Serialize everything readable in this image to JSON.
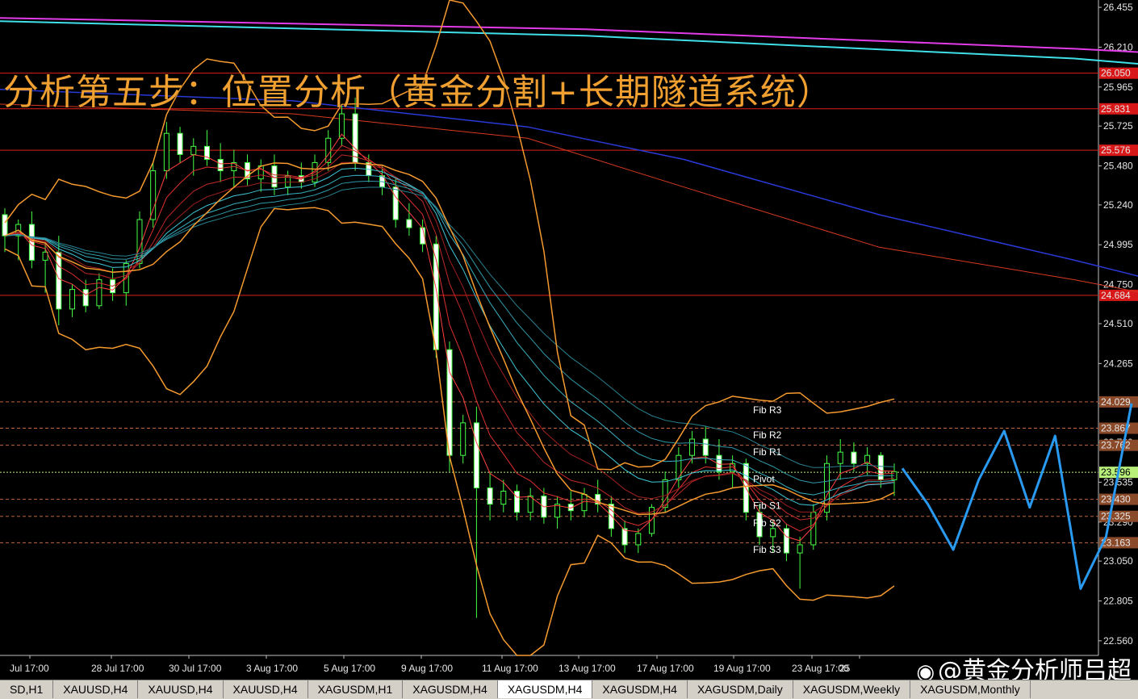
{
  "title": "分析第五步：位置分析（黄金分割+长期隧道系统）",
  "watermark": {
    "icon": "weibo-icon",
    "text": "@黄金分析师吕超"
  },
  "tabs": [
    {
      "label": "SD,H1",
      "active": false
    },
    {
      "label": "XAUUSD,H4",
      "active": false
    },
    {
      "label": "XAUUSD,H4",
      "active": false
    },
    {
      "label": "XAUUSD,H4",
      "active": false
    },
    {
      "label": "XAGUSDM,H1",
      "active": false
    },
    {
      "label": "XAGUSDM,H4",
      "active": false
    },
    {
      "label": "XAGUSDM,H4",
      "active": true
    },
    {
      "label": "XAGUSDM,H4",
      "active": false
    },
    {
      "label": "XAGUSDM,Daily",
      "active": false
    },
    {
      "label": "XAGUSDM,Weekly",
      "active": false
    },
    {
      "label": "XAGUSDM,Monthly",
      "active": false
    }
  ],
  "colors": {
    "background": "#000000",
    "bull_candle": "#44ff44",
    "bear_candle": "#ffffff",
    "bollinger": "#f59a2e",
    "level_line": "#e0201a",
    "current_price": "#b8f07a",
    "forecast": "#2a9af0",
    "magenta_ma": "#e23be8",
    "cyan_ma": "#40e0e8",
    "blue_ma": "#2a3ad8",
    "red_ma": "#d83a20"
  },
  "chart_data": {
    "type": "candlestick",
    "symbol": "XAGUSDM,H4",
    "ylim": [
      22.47,
      26.5
    ],
    "y_ticks": [
      26.455,
      26.21,
      25.965,
      25.725,
      25.48,
      25.24,
      24.995,
      24.75,
      24.51,
      24.265,
      24.02,
      23.78,
      23.535,
      23.29,
      23.05,
      22.805,
      22.56
    ],
    "x_ticks": [
      "Jul 17:00",
      "28 Jul 17:00",
      "30 Jul 17:00",
      "3 Aug 17:00",
      "5 Aug 17:00",
      "9 Aug 17:00",
      "11 Aug 17:00",
      "13 Aug 17:00",
      "17 Aug 17:00",
      "19 Aug 17:00",
      "23 Aug 17:00",
      "25"
    ],
    "horizontal_levels": [
      {
        "price": 26.05,
        "label": "26.050",
        "style": "solid",
        "box": "#d81818"
      },
      {
        "price": 25.831,
        "label": "25.831",
        "style": "solid",
        "box": "#d81818"
      },
      {
        "price": 25.576,
        "label": "25.576",
        "style": "solid",
        "box": "#d81818"
      },
      {
        "price": 24.684,
        "label": "24.684",
        "style": "solid",
        "box": "#d81818"
      },
      {
        "price": 24.029,
        "label": "24.029",
        "style": "dashed",
        "box": "#8a4a2a"
      },
      {
        "price": 23.867,
        "label": "23.867",
        "style": "dashed",
        "box": "#8a4a2a"
      },
      {
        "price": 23.762,
        "label": "23.762",
        "style": "dashed",
        "box": "#8a4a2a"
      },
      {
        "price": 23.596,
        "label": "23.596",
        "style": "dotted",
        "box": "#b8f07a"
      },
      {
        "price": 23.43,
        "label": "23.430",
        "style": "dashed",
        "box": "#8a4a2a"
      },
      {
        "price": 23.325,
        "label": "23.325",
        "style": "dashed",
        "box": "#8a4a2a"
      },
      {
        "price": 23.163,
        "label": "23.163",
        "style": "dashed",
        "box": "#8a4a2a"
      }
    ],
    "fib_labels": [
      {
        "label": "Fib R3",
        "price": 23.98
      },
      {
        "label": "Fib R2",
        "price": 23.825
      },
      {
        "label": "Fib R1",
        "price": 23.72
      },
      {
        "label": "Pivot",
        "price": 23.555
      },
      {
        "label": "Fib S1",
        "price": 23.39
      },
      {
        "label": "Fib S2",
        "price": 23.285
      },
      {
        "label": "Fib S3",
        "price": 23.12
      }
    ],
    "candles": [
      [
        25.18,
        25.22,
        24.95,
        25.05
      ],
      [
        25.05,
        25.15,
        24.9,
        25.12
      ],
      [
        25.12,
        25.2,
        24.85,
        24.9
      ],
      [
        24.9,
        25.0,
        24.7,
        24.95
      ],
      [
        24.95,
        25.05,
        24.5,
        24.6
      ],
      [
        24.6,
        24.75,
        24.55,
        24.72
      ],
      [
        24.72,
        24.78,
        24.58,
        24.62
      ],
      [
        24.62,
        24.82,
        24.6,
        24.78
      ],
      [
        24.78,
        24.85,
        24.65,
        24.7
      ],
      [
        24.7,
        24.9,
        24.62,
        24.88
      ],
      [
        24.88,
        25.2,
        24.85,
        25.15
      ],
      [
        25.15,
        25.5,
        25.1,
        25.45
      ],
      [
        25.45,
        25.75,
        25.4,
        25.68
      ],
      [
        25.68,
        25.72,
        25.5,
        25.55
      ],
      [
        25.55,
        25.65,
        25.42,
        25.6
      ],
      [
        25.6,
        25.7,
        25.48,
        25.52
      ],
      [
        25.52,
        25.62,
        25.38,
        25.45
      ],
      [
        25.45,
        25.58,
        25.35,
        25.5
      ],
      [
        25.5,
        25.55,
        25.36,
        25.4
      ],
      [
        25.4,
        25.52,
        25.32,
        25.48
      ],
      [
        25.48,
        25.55,
        25.3,
        25.35
      ],
      [
        25.35,
        25.45,
        25.3,
        25.42
      ],
      [
        25.42,
        25.5,
        25.34,
        25.38
      ],
      [
        25.38,
        25.55,
        25.35,
        25.5
      ],
      [
        25.5,
        25.7,
        25.45,
        25.65
      ],
      [
        25.65,
        25.85,
        25.6,
        25.8
      ],
      [
        25.8,
        25.9,
        25.45,
        25.5
      ],
      [
        25.5,
        25.55,
        25.38,
        25.42
      ],
      [
        25.42,
        25.48,
        25.3,
        25.35
      ],
      [
        25.35,
        25.4,
        25.1,
        25.15
      ],
      [
        25.15,
        25.25,
        25.05,
        25.1
      ],
      [
        25.1,
        25.15,
        24.95,
        25.0
      ],
      [
        25.0,
        25.05,
        24.3,
        24.35
      ],
      [
        24.35,
        24.4,
        23.6,
        23.7
      ],
      [
        23.7,
        23.95,
        23.65,
        23.9
      ],
      [
        23.9,
        24.0,
        22.7,
        23.5
      ],
      [
        23.5,
        23.6,
        23.3,
        23.4
      ],
      [
        23.4,
        23.55,
        23.35,
        23.48
      ],
      [
        23.48,
        23.52,
        23.3,
        23.35
      ],
      [
        23.35,
        23.5,
        23.3,
        23.45
      ],
      [
        23.45,
        23.5,
        23.28,
        23.32
      ],
      [
        23.32,
        23.45,
        23.25,
        23.4
      ],
      [
        23.4,
        23.48,
        23.3,
        23.36
      ],
      [
        23.36,
        23.5,
        23.32,
        23.46
      ],
      [
        23.46,
        23.55,
        23.35,
        23.4
      ],
      [
        23.4,
        23.45,
        23.2,
        23.25
      ],
      [
        23.25,
        23.3,
        23.1,
        23.15
      ],
      [
        23.15,
        23.25,
        23.1,
        23.22
      ],
      [
        23.22,
        23.4,
        23.2,
        23.38
      ],
      [
        23.38,
        23.6,
        23.35,
        23.55
      ],
      [
        23.55,
        23.75,
        23.5,
        23.7
      ],
      [
        23.7,
        23.85,
        23.65,
        23.8
      ],
      [
        23.8,
        23.88,
        23.65,
        23.7
      ],
      [
        23.7,
        23.8,
        23.55,
        23.6
      ],
      [
        23.6,
        23.7,
        23.5,
        23.65
      ],
      [
        23.65,
        23.68,
        23.3,
        23.35
      ],
      [
        23.35,
        23.4,
        23.15,
        23.2
      ],
      [
        23.2,
        23.3,
        23.1,
        23.25
      ],
      [
        23.25,
        23.28,
        23.05,
        23.1
      ],
      [
        23.1,
        23.2,
        22.88,
        23.15
      ],
      [
        23.15,
        23.4,
        23.12,
        23.35
      ],
      [
        23.35,
        23.7,
        23.3,
        23.65
      ],
      [
        23.65,
        23.8,
        23.55,
        23.72
      ],
      [
        23.72,
        23.78,
        23.6,
        23.65
      ],
      [
        23.65,
        23.75,
        23.58,
        23.7
      ],
      [
        23.7,
        23.72,
        23.5,
        23.55
      ],
      [
        23.55,
        23.65,
        23.45,
        23.6
      ]
    ],
    "ma_magenta": [
      [
        0,
        26.39
      ],
      [
        0.3,
        26.32
      ],
      [
        0.55,
        26.2
      ],
      [
        0.79,
        26.05
      ]
    ],
    "ma_cyan": [
      [
        0,
        26.37
      ],
      [
        0.3,
        26.28
      ],
      [
        0.55,
        26.14
      ],
      [
        0.79,
        25.9
      ]
    ],
    "ma_blue": [
      [
        0,
        25.95
      ],
      [
        0.15,
        25.88
      ],
      [
        0.27,
        25.72
      ],
      [
        0.35,
        25.52
      ],
      [
        0.45,
        25.18
      ],
      [
        0.55,
        24.9
      ],
      [
        0.65,
        24.6
      ],
      [
        0.79,
        24.36
      ]
    ],
    "ma_red": [
      [
        0,
        25.86
      ],
      [
        0.15,
        25.8
      ],
      [
        0.27,
        25.65
      ],
      [
        0.35,
        25.35
      ],
      [
        0.45,
        24.98
      ],
      [
        0.55,
        24.78
      ],
      [
        0.65,
        24.55
      ],
      [
        0.79,
        24.22
      ]
    ],
    "forecast_path": [
      [
        23.62
      ],
      [
        23.4
      ],
      [
        23.12
      ],
      [
        23.55
      ],
      [
        23.85
      ],
      [
        23.38
      ],
      [
        23.82
      ],
      [
        22.88
      ],
      [
        23.2
      ],
      [
        24.02
      ]
    ]
  }
}
